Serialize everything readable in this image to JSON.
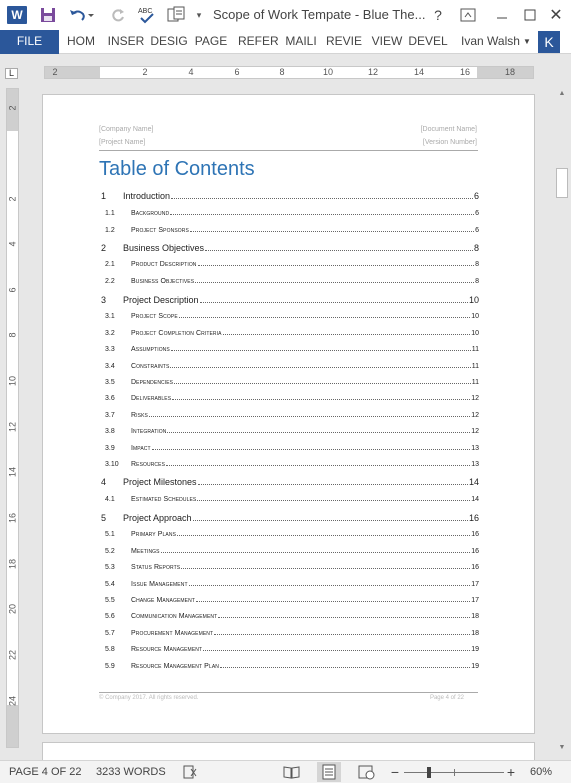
{
  "titlebar": {
    "app_logo": "W",
    "document_title": "Scope of Work Tempate - Blue The...",
    "help": "?",
    "close": "✕",
    "icons": [
      "word-logo-icon",
      "save-icon",
      "undo-icon",
      "redo-icon",
      "spelling-icon",
      "touch-mode-icon",
      "customize-toolbar-icon",
      "help-icon",
      "ribbon-display-icon",
      "minimize-icon",
      "maximize-icon",
      "close-icon"
    ]
  },
  "ribbon": {
    "tabs": [
      "FILE",
      "HOM",
      "INSER",
      "DESIG",
      "PAGE",
      "REFER",
      "MAILI",
      "REVIE",
      "VIEW",
      "DEVEL"
    ],
    "user_name": "Ivan Walsh",
    "user_initial": "K",
    "file_color": "#2b579a"
  },
  "ruler": {
    "corner": "L",
    "horizontal_labels": [
      "2",
      "2",
      "4",
      "6",
      "8",
      "10",
      "12",
      "14",
      "16",
      "18"
    ],
    "vertical_labels": [
      "2",
      "2",
      "4",
      "6",
      "8",
      "10",
      "12",
      "14",
      "16",
      "18",
      "20",
      "22",
      "24"
    ]
  },
  "document": {
    "header": {
      "company": "[Company Name]",
      "document": "[Document Name]",
      "project": "[Project Name]",
      "version": "[Version Number]"
    },
    "toc_title": "Table of Contents",
    "toc_title_color": "#2e74b5",
    "toc": [
      {
        "level": 1,
        "num": "1",
        "label": "Introduction",
        "page": "6"
      },
      {
        "level": 2,
        "num": "1.1",
        "label": "Background",
        "page": "6"
      },
      {
        "level": 2,
        "num": "1.2",
        "label": "Project Sponsors",
        "page": "6"
      },
      {
        "level": 1,
        "num": "2",
        "label": "Business Objectives",
        "page": "8"
      },
      {
        "level": 2,
        "num": "2.1",
        "label": "Product Description",
        "page": "8"
      },
      {
        "level": 2,
        "num": "2.2",
        "label": "Business Objectives",
        "page": "8"
      },
      {
        "level": 1,
        "num": "3",
        "label": "Project Description",
        "page": "10"
      },
      {
        "level": 2,
        "num": "3.1",
        "label": "Project Scope",
        "page": "10"
      },
      {
        "level": 2,
        "num": "3.2",
        "label": "Project Completion Criteria",
        "page": "10"
      },
      {
        "level": 2,
        "num": "3.3",
        "label": "Assumptions",
        "page": "11"
      },
      {
        "level": 2,
        "num": "3.4",
        "label": "Constraints",
        "page": "11"
      },
      {
        "level": 2,
        "num": "3.5",
        "label": "Dependencies",
        "page": "11"
      },
      {
        "level": 2,
        "num": "3.6",
        "label": "Deliverables",
        "page": "12"
      },
      {
        "level": 2,
        "num": "3.7",
        "label": "Risks",
        "page": "12"
      },
      {
        "level": 2,
        "num": "3.8",
        "label": "Integration",
        "page": "12"
      },
      {
        "level": 2,
        "num": "3.9",
        "label": "Impact",
        "page": "13"
      },
      {
        "level": 2,
        "num": "3.10",
        "label": "Resources",
        "page": "13"
      },
      {
        "level": 1,
        "num": "4",
        "label": "Project Milestones",
        "page": "14"
      },
      {
        "level": 2,
        "num": "4.1",
        "label": "Estimated Schedules",
        "page": "14"
      },
      {
        "level": 1,
        "num": "5",
        "label": "Project Approach",
        "page": "16"
      },
      {
        "level": 2,
        "num": "5.1",
        "label": "Primary Plans",
        "page": "16"
      },
      {
        "level": 2,
        "num": "5.2",
        "label": "Meetings",
        "page": "16"
      },
      {
        "level": 2,
        "num": "5.3",
        "label": "Status Reports",
        "page": "16"
      },
      {
        "level": 2,
        "num": "5.4",
        "label": "Issue Management",
        "page": "17"
      },
      {
        "level": 2,
        "num": "5.5",
        "label": "Change Management",
        "page": "17"
      },
      {
        "level": 2,
        "num": "5.6",
        "label": "Communication Management",
        "page": "18"
      },
      {
        "level": 2,
        "num": "5.7",
        "label": "Procurement Management",
        "page": "18"
      },
      {
        "level": 2,
        "num": "5.8",
        "label": "Resource Management",
        "page": "19"
      },
      {
        "level": 2,
        "num": "5.9",
        "label": "Resource Management Plan",
        "page": "19"
      }
    ],
    "footer": {
      "left": "© Company 2017. All rights reserved.",
      "right": "Page 4 of 22"
    }
  },
  "statusbar": {
    "page": "PAGE 4 OF 22",
    "words": "3233 WORDS",
    "zoom_out": "−",
    "zoom_in": "+",
    "zoom": "60%",
    "zoom_fraction": 0.25
  }
}
